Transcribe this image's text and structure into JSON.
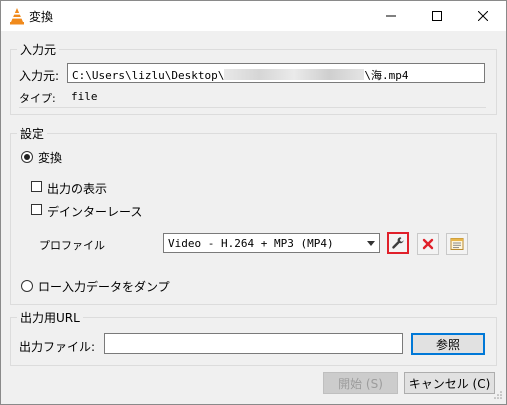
{
  "window": {
    "title": "変換"
  },
  "source": {
    "legend": "入力元",
    "label": "入力元:",
    "path_prefix": "C:\\Users\\lizlu\\Desktop\\",
    "path_suffix": "\\海.mp4",
    "type_label": "タイプ:",
    "type_value": "file"
  },
  "settings": {
    "legend": "設定",
    "convert_label": "変換",
    "show_output_label": "出力の表示",
    "deinterlace_label": "デインターレース",
    "profile_label": "プロファイル",
    "profile_value": "Video - H.264 + MP3 (MP4)",
    "dump_label": "ロー入力データをダンプ"
  },
  "output": {
    "legend": "出力用URL",
    "file_label": "出力ファイル:",
    "file_value": "",
    "browse_label": "参照"
  },
  "footer": {
    "start_label": "開始 (S)",
    "cancel_label": "キャンセル (C)"
  },
  "colors": {
    "accent_red": "#e0202a",
    "vlc_orange": "#f08a1c",
    "focus_blue": "#0078d7"
  }
}
